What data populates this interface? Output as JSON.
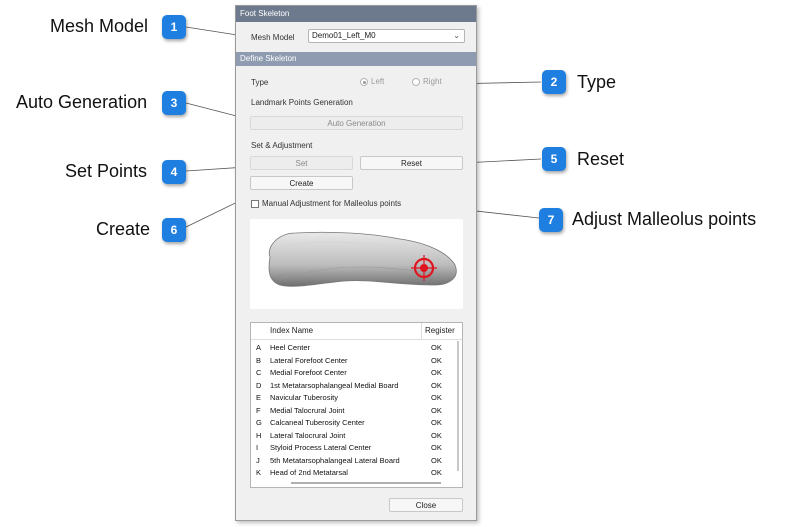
{
  "callouts": [
    {
      "num": "1",
      "label": "Mesh Model"
    },
    {
      "num": "2",
      "label": "Type"
    },
    {
      "num": "3",
      "label": "Auto Generation"
    },
    {
      "num": "4",
      "label": "Set Points"
    },
    {
      "num": "5",
      "label": "Reset"
    },
    {
      "num": "6",
      "label": "Create"
    },
    {
      "num": "7",
      "label": "Adjust Malleolus points"
    }
  ],
  "panel": {
    "title": "Foot Skeleton",
    "mesh_model_label": "Mesh Model",
    "mesh_model_value": "Demo01_Left_M0",
    "define_skeleton": "Define Skeleton",
    "type_label": "Type",
    "type_left": "Left",
    "type_right": "Right",
    "landmark_heading": "Landmark Points Generation",
    "auto_generation": "Auto Generation",
    "set_adjust_heading": "Set & Adjustment",
    "set": "Set",
    "reset": "Reset",
    "create": "Create",
    "manual_adjust": "Manual Adjustment for Malleolus points",
    "close": "Close"
  },
  "table": {
    "headers": [
      "Index Name",
      "Register"
    ],
    "rows": [
      {
        "idx": "A",
        "name": "Heel Center",
        "status": "OK"
      },
      {
        "idx": "B",
        "name": "Lateral Forefoot Center",
        "status": "OK"
      },
      {
        "idx": "C",
        "name": "Medial Forefoot Center",
        "status": "OK"
      },
      {
        "idx": "D",
        "name": "1st Metatarsophalangeal Medial Board",
        "status": "OK"
      },
      {
        "idx": "E",
        "name": "Navicular Tuberosity",
        "status": "OK"
      },
      {
        "idx": "F",
        "name": "Medial Talocrural Joint",
        "status": "OK"
      },
      {
        "idx": "G",
        "name": "Calcaneal Tuberosity Center",
        "status": "OK"
      },
      {
        "idx": "H",
        "name": "Lateral Talocrural Joint",
        "status": "OK"
      },
      {
        "idx": "I",
        "name": "Styloid Process Lateral Center",
        "status": "OK"
      },
      {
        "idx": "J",
        "name": "5th Metatarsophalangeal Lateral Board",
        "status": "OK"
      },
      {
        "idx": "K",
        "name": "Head of 2nd Metatarsal",
        "status": "OK"
      }
    ]
  },
  "colors": {
    "badge": "#1f7fe0",
    "titlebar": "#6d7a8e",
    "section": "#8e9bb0",
    "target": "#e0141e"
  }
}
